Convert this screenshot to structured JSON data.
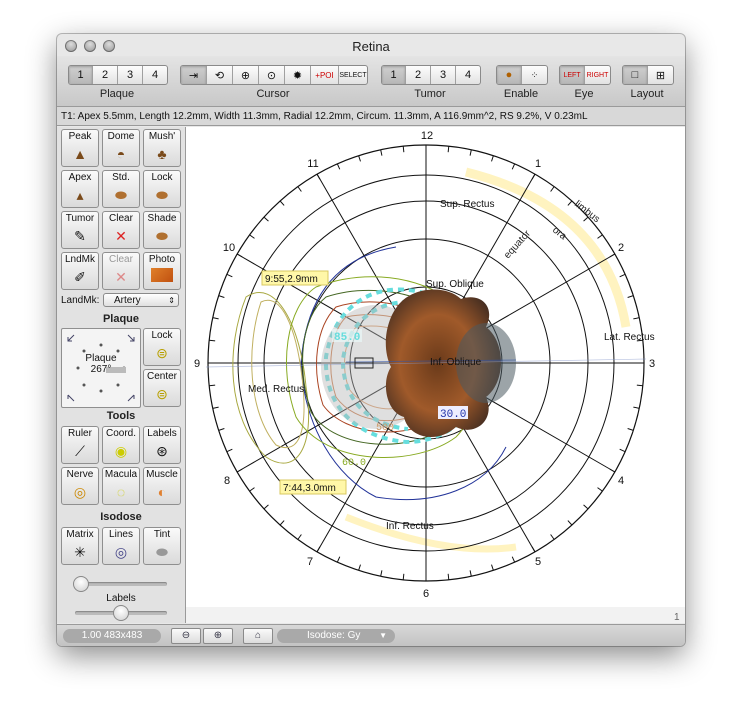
{
  "window": {
    "title": "Retina"
  },
  "toolbar": {
    "plaque": {
      "label": "Plaque",
      "items": [
        "1",
        "2",
        "3",
        "4"
      ]
    },
    "cursor": {
      "label": "Cursor"
    },
    "tumor": {
      "label": "Tumor",
      "items": [
        "1",
        "2",
        "3",
        "4"
      ]
    },
    "enable": {
      "label": "Enable"
    },
    "eye": {
      "label": "Eye",
      "left": "LEFT",
      "right": "RIGHT"
    },
    "layout": {
      "label": "Layout"
    }
  },
  "info": "T1: Apex 5.5mm, Length 12.2mm, Width 11.3mm, Radial 12.2mm, Circum. 11.3mm, A 116.9mm^2, RS 9.2%, V 0.23mL",
  "sidebar": {
    "rows": [
      [
        "Peak",
        "Dome",
        "Mush'"
      ],
      [
        "Apex",
        "Std.",
        "Lock"
      ],
      [
        "Tumor",
        "Clear",
        "Shade"
      ],
      [
        "LndMk",
        "Clear",
        "Photo"
      ]
    ],
    "landmark_label": "LandMk:",
    "landmark_value": "Artery",
    "plaque_section": "Plaque",
    "plaque_text": "Plaque",
    "plaque_angle": "267°",
    "lock": "Lock",
    "center": "Center",
    "tools_section": "Tools",
    "tools": [
      [
        "Ruler",
        "Coord.",
        "Labels"
      ],
      [
        "Nerve",
        "Macula",
        "Muscle"
      ]
    ],
    "isodose_section": "Isodose",
    "isodose": [
      "Matrix",
      "Lines",
      "Tint"
    ],
    "labels_slider": "Labels"
  },
  "plot": {
    "clock": [
      "12",
      "1",
      "2",
      "3",
      "4",
      "5",
      "6",
      "7",
      "8",
      "9",
      "10",
      "11"
    ],
    "rings": [
      "limbus",
      "ora",
      "equator"
    ],
    "muscles": [
      "Sup. Rectus",
      "Sup. Oblique",
      "Lat. Rectus",
      "Inf. Oblique",
      "Med. Rectus",
      "Inf. Rectus"
    ],
    "isodose_labels": [
      "85.0",
      "30.0",
      "60.0",
      "500"
    ],
    "callouts": [
      "9:55,2.9mm",
      "7:44,3.0mm"
    ],
    "scroll_value": "1"
  },
  "status": {
    "zoom": "1.00 483x483",
    "isodose": "Isodose: Gy"
  },
  "colors": {
    "window_bg": "#e8e8e8",
    "callout": "#fff7a8",
    "cyan": "#66dddd",
    "tumor": "#8a4a24"
  }
}
